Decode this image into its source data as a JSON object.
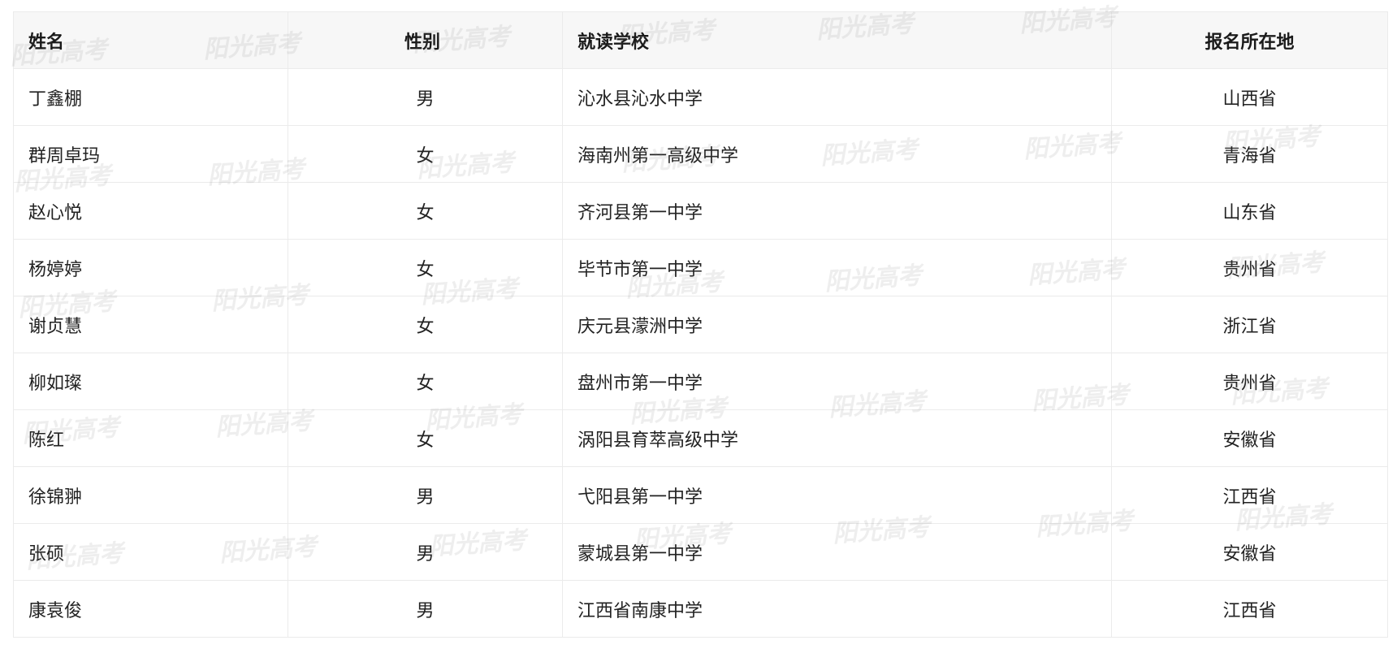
{
  "table": {
    "headers": {
      "name": "姓名",
      "gender": "性别",
      "school": "就读学校",
      "location": "报名所在地"
    },
    "rows": [
      {
        "name": "丁鑫棚",
        "gender": "男",
        "school": "沁水县沁水中学",
        "location": "山西省"
      },
      {
        "name": "群周卓玛",
        "gender": "女",
        "school": "海南州第一高级中学",
        "location": "青海省"
      },
      {
        "name": "赵心悦",
        "gender": "女",
        "school": "齐河县第一中学",
        "location": "山东省"
      },
      {
        "name": "杨婷婷",
        "gender": "女",
        "school": "毕节市第一中学",
        "location": "贵州省"
      },
      {
        "name": "谢贞慧",
        "gender": "女",
        "school": "庆元县濛洲中学",
        "location": "浙江省"
      },
      {
        "name": "柳如璨",
        "gender": "女",
        "school": "盘州市第一中学",
        "location": "贵州省"
      },
      {
        "name": "陈红",
        "gender": "女",
        "school": "涡阳县育萃高级中学",
        "location": "安徽省"
      },
      {
        "name": "徐锦翀",
        "gender": "男",
        "school": "弋阳县第一中学",
        "location": "江西省"
      },
      {
        "name": "张硕",
        "gender": "男",
        "school": "蒙城县第一中学",
        "location": "安徽省"
      },
      {
        "name": "康袁俊",
        "gender": "男",
        "school": "江西省南康中学",
        "location": "江西省"
      }
    ]
  },
  "watermark": {
    "text": "阳光高考"
  }
}
